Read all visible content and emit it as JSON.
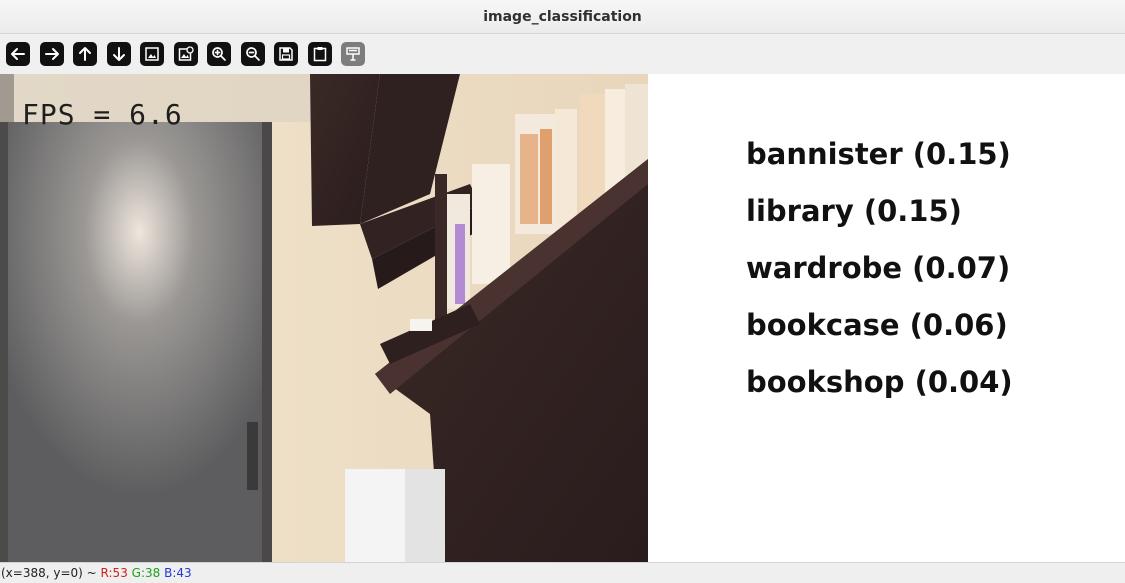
{
  "window": {
    "title": "image_classification"
  },
  "toolbar": {
    "buttons": [
      {
        "icon": "arrow-left-icon"
      },
      {
        "icon": "arrow-right-icon"
      },
      {
        "icon": "arrow-up-icon"
      },
      {
        "icon": "arrow-down-icon"
      },
      {
        "icon": "zoom-fit-icon"
      },
      {
        "icon": "zoom-actual-icon"
      },
      {
        "icon": "zoom-in-icon"
      },
      {
        "icon": "zoom-out-icon"
      },
      {
        "icon": "save-icon"
      },
      {
        "icon": "copy-clipboard-icon"
      },
      {
        "icon": "properties-icon",
        "disabled": true
      }
    ]
  },
  "camera": {
    "fps_text": "FPS = 6.6"
  },
  "results": [
    {
      "label": "bannister (0.15)"
    },
    {
      "label": "library (0.15)"
    },
    {
      "label": "wardrobe (0.07)"
    },
    {
      "label": "bookcase (0.06)"
    },
    {
      "label": "bookshop (0.04)"
    }
  ],
  "status": {
    "coords": "(x=388, y=0) ~",
    "r": "R:53",
    "g": "G:38",
    "b": "B:43"
  }
}
